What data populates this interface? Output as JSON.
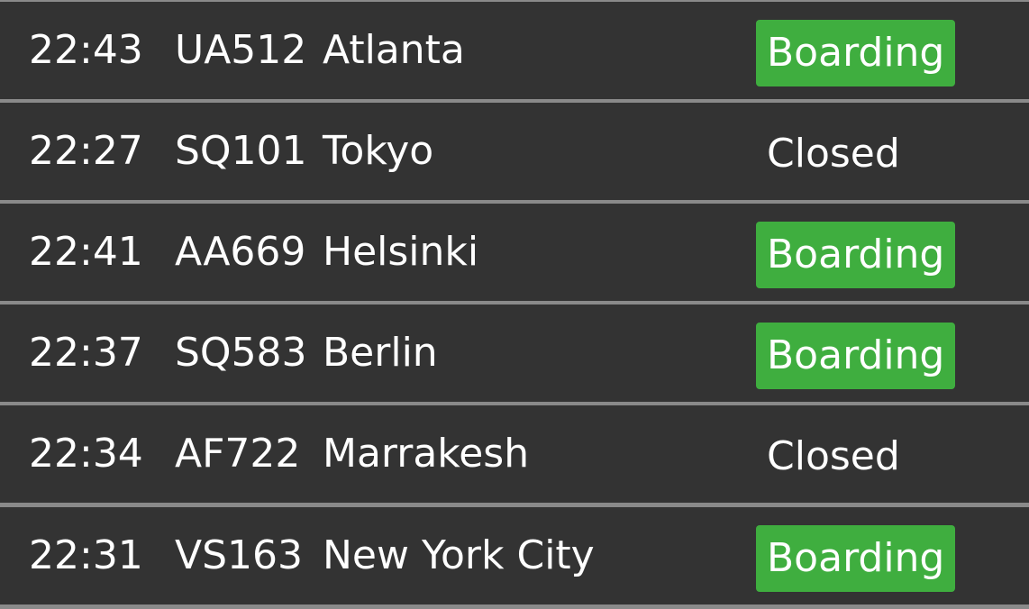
{
  "board": {
    "flights": [
      {
        "time": "22:43",
        "flight": "UA512",
        "destination": "Atlanta",
        "status": "Boarding"
      },
      {
        "time": "22:27",
        "flight": "SQ101",
        "destination": "Tokyo",
        "status": "Closed"
      },
      {
        "time": "22:41",
        "flight": "AA669",
        "destination": "Helsinki",
        "status": "Boarding"
      },
      {
        "time": "22:37",
        "flight": "SQ583",
        "destination": "Berlin",
        "status": "Boarding"
      },
      {
        "time": "22:34",
        "flight": "AF722",
        "destination": "Marrakesh",
        "status": "Closed"
      },
      {
        "time": "22:31",
        "flight": "VS163",
        "destination": "New York City",
        "status": "Boarding"
      }
    ]
  },
  "colors": {
    "row_background": "#333333",
    "separator": "#8a8a8a",
    "boarding_badge": "#3fae3f",
    "text": "#ffffff"
  }
}
